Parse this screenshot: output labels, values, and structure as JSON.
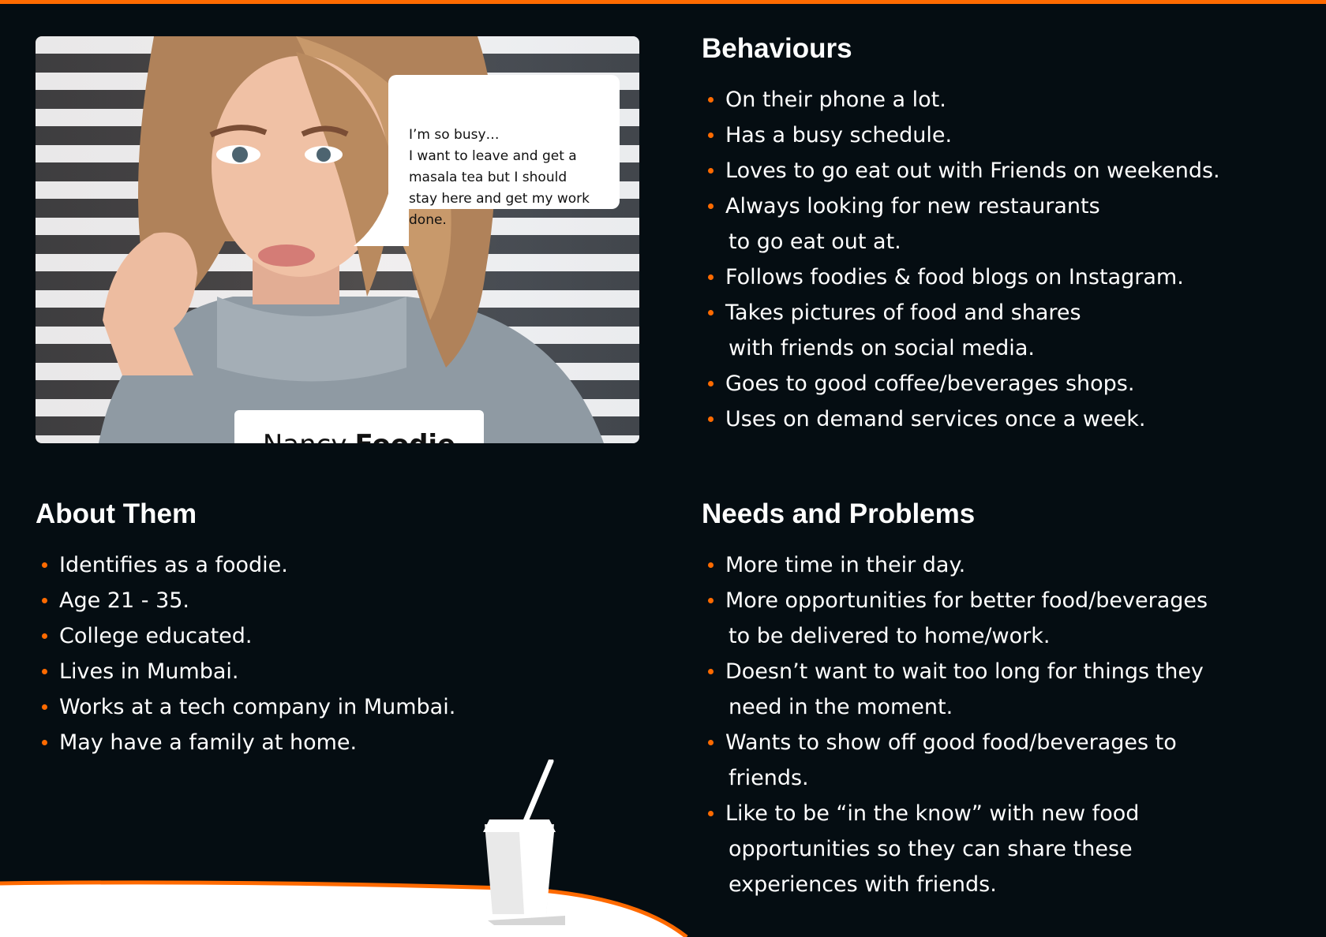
{
  "colors": {
    "background": "#050d12",
    "accent": "#ff6a00",
    "text": "#ffffff"
  },
  "persona": {
    "first_name": "Nancy",
    "last_name": "Foodie",
    "quote": "I’m so busy…\nI want to leave and get a\nmasala tea but I should\nstay here and get my work\ndone."
  },
  "behaviours": {
    "title": "Behaviours",
    "items": [
      [
        "On their phone a lot."
      ],
      [
        "Has a busy schedule."
      ],
      [
        "Loves to go eat out with Friends on weekends."
      ],
      [
        "Always looking for new restaurants",
        "to go eat out at."
      ],
      [
        "Follows foodies & food blogs on Instagram."
      ],
      [
        "Takes pictures of food and shares",
        "with friends on social media."
      ],
      [
        "Goes to good coffee/beverages shops."
      ],
      [
        "Uses on demand services once a week."
      ]
    ]
  },
  "about": {
    "title": "About Them",
    "items": [
      [
        "Identifies as a foodie."
      ],
      [
        "Age 21 - 35."
      ],
      [
        "College educated."
      ],
      [
        "Lives in Mumbai."
      ],
      [
        "Works at a tech company in Mumbai."
      ],
      [
        "May have a family at home."
      ]
    ]
  },
  "needs": {
    "title": "Needs and Problems",
    "items": [
      [
        "More time in their day."
      ],
      [
        "More opportunities for better food/beverages",
        "to be delivered to home/work."
      ],
      [
        "Doesn’t want to wait too long for things they",
        "need in the moment."
      ],
      [
        "Wants to show off good food/beverages to",
        "friends."
      ],
      [
        "Like to be “in the know” with new food",
        "opportunities so they can share these",
        "experiences with friends."
      ]
    ]
  },
  "icons": {
    "decoration": "drink-cup-icon",
    "photo": "persona-photo"
  }
}
